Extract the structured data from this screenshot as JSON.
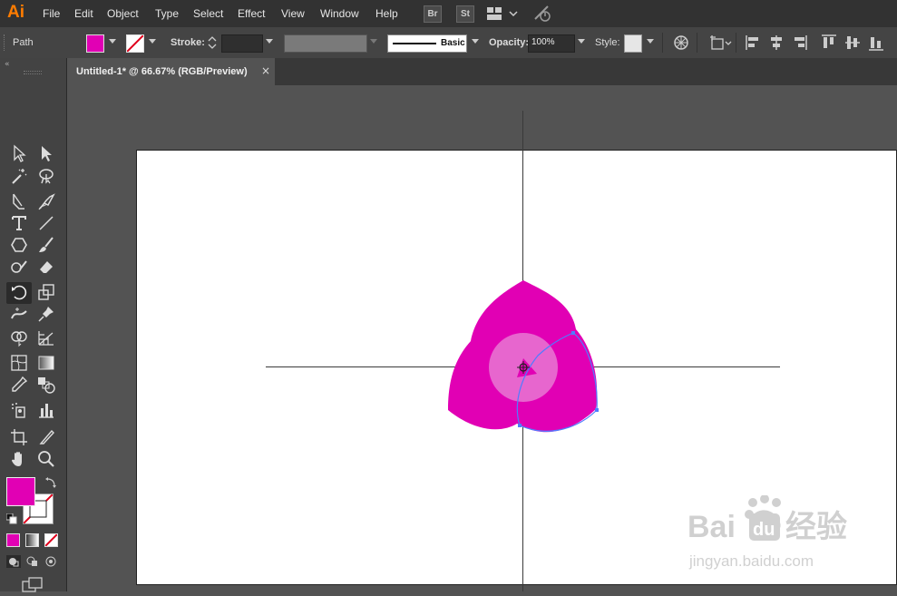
{
  "app": {
    "logo": "Ai",
    "accent": "#ff7c00"
  },
  "menu": {
    "items": [
      {
        "label": "File"
      },
      {
        "label": "Edit"
      },
      {
        "label": "Object"
      },
      {
        "label": "Type"
      },
      {
        "label": "Select"
      },
      {
        "label": "Effect"
      },
      {
        "label": "View"
      },
      {
        "label": "Window"
      },
      {
        "label": "Help"
      }
    ],
    "bridge_badge": "Br",
    "stock_badge": "St"
  },
  "control_bar": {
    "selection_type": "Path",
    "fill_color": "#e100b4",
    "stroke_label": "Stroke:",
    "stroke_profile": "Basic",
    "opacity_label": "Opacity:",
    "opacity_value": "100%",
    "style_label": "Style:"
  },
  "document": {
    "tab_title": "Untitled-1* @ 66.67% (RGB/Preview)",
    "close_glyph": "×"
  },
  "toolbar": {
    "fill_color": "#e100b4",
    "stroke_color": "none",
    "tools": [
      {
        "name": "selection-tool",
        "icon": "selection-arrow-icon"
      },
      {
        "name": "direct-selection-tool",
        "icon": "direct-selection-arrow-icon"
      },
      {
        "name": "magic-wand-tool",
        "icon": "magic-wand-icon"
      },
      {
        "name": "lasso-tool",
        "icon": "lasso-icon"
      },
      {
        "name": "pen-tool",
        "icon": "pen-icon"
      },
      {
        "name": "curvature-tool",
        "icon": "curvature-icon"
      },
      {
        "name": "type-tool",
        "icon": "type-icon"
      },
      {
        "name": "line-tool",
        "icon": "line-segment-icon"
      },
      {
        "name": "shape-tool",
        "icon": "hexagon-icon"
      },
      {
        "name": "paintbrush-tool",
        "icon": "paintbrush-icon"
      },
      {
        "name": "shaper-tool",
        "icon": "shaper-icon"
      },
      {
        "name": "eraser-tool",
        "icon": "eraser-icon"
      },
      {
        "name": "rotate-tool",
        "icon": "rotate-icon"
      },
      {
        "name": "scale-tool",
        "icon": "scale-icon"
      },
      {
        "name": "width-tool",
        "icon": "width-icon"
      },
      {
        "name": "puppet-warp-tool",
        "icon": "pushpin-icon"
      },
      {
        "name": "shape-builder-tool",
        "icon": "shape-builder-icon"
      },
      {
        "name": "perspective-grid-tool",
        "icon": "perspective-grid-icon"
      },
      {
        "name": "mesh-tool",
        "icon": "mesh-icon"
      },
      {
        "name": "gradient-tool",
        "icon": "gradient-icon"
      },
      {
        "name": "eyedropper-tool",
        "icon": "eyedropper-icon"
      },
      {
        "name": "blend-tool",
        "icon": "blend-icon"
      },
      {
        "name": "symbol-sprayer-tool",
        "icon": "symbol-sprayer-icon"
      },
      {
        "name": "column-graph-tool",
        "icon": "column-graph-icon"
      },
      {
        "name": "artboard-tool",
        "icon": "artboard-icon"
      },
      {
        "name": "slice-tool",
        "icon": "slice-icon"
      },
      {
        "name": "hand-tool",
        "icon": "hand-icon"
      },
      {
        "name": "zoom-tool",
        "icon": "zoom-icon"
      }
    ]
  },
  "artwork": {
    "shape_color": "#e100b4",
    "highlight_color": "#e878d2",
    "path_color": "#4f7cff"
  },
  "watermark": {
    "brand": "Bai",
    "brand_tail": "经验",
    "url": "jingyan.baidu.com"
  }
}
